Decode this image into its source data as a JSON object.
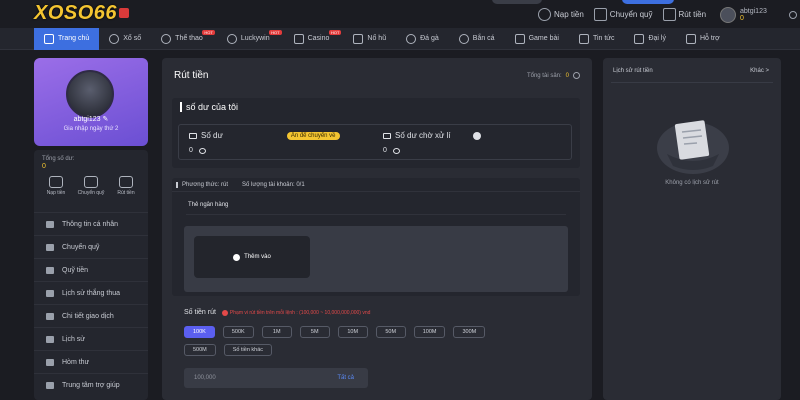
{
  "brand": {
    "logo_text": "XOSO66"
  },
  "top_actions": [
    {
      "label": "Nạp tiền",
      "icon": "deposit-icon"
    },
    {
      "label": "Chuyển quỹ",
      "icon": "transfer-icon"
    },
    {
      "label": "Rút tiền",
      "icon": "withdraw-icon"
    }
  ],
  "user": {
    "name": "abtgi123",
    "balance": "0"
  },
  "nav": [
    {
      "label": "Trang chủ",
      "icon": "home-icon",
      "hot": false,
      "active": true
    },
    {
      "label": "Xổ số",
      "icon": "lottery-icon",
      "hot": false
    },
    {
      "label": "Thể thao",
      "icon": "sports-icon",
      "hot": true
    },
    {
      "label": "Luckywin",
      "icon": "luckywin-icon",
      "hot": true
    },
    {
      "label": "Casino",
      "icon": "casino-icon",
      "hot": true
    },
    {
      "label": "Nổ hũ",
      "icon": "slots-icon",
      "hot": false
    },
    {
      "label": "Đá gà",
      "icon": "cockfight-icon",
      "hot": false
    },
    {
      "label": "Bắn cá",
      "icon": "fish-icon",
      "hot": false
    },
    {
      "label": "Game bài",
      "icon": "cards-icon",
      "hot": false
    },
    {
      "label": "Tin tức",
      "icon": "news-icon",
      "hot": false
    },
    {
      "label": "Đại lý",
      "icon": "agent-icon",
      "hot": false
    },
    {
      "label": "Hỗ trợ",
      "icon": "support-icon",
      "hot": false
    }
  ],
  "hot_badge": "HOT",
  "profile": {
    "username": "abtgi123",
    "login_text": "Gia nhập ngày thứ 2"
  },
  "sidebar": {
    "total_label": "Tổng số dư:",
    "total_value": "0",
    "quick": [
      {
        "label": "Nạp tiền"
      },
      {
        "label": "Chuyển quỹ"
      },
      {
        "label": "Rút tiền"
      }
    ],
    "menu": [
      {
        "label": "Thông tin cá nhân"
      },
      {
        "label": "Chuyển quỹ"
      },
      {
        "label": "Quỹ tiền"
      },
      {
        "label": "Lịch sử thắng thua"
      },
      {
        "label": "Chi tiết giao dịch"
      },
      {
        "label": "Lịch sử"
      },
      {
        "label": "Hòm thư"
      },
      {
        "label": "Trung tâm trợ giúp"
      }
    ]
  },
  "withdraw": {
    "title": "Rút tiền",
    "total_assets_label": "Tổng tài sản:",
    "total_assets_value": "0",
    "balance_title": "số dư của tôi",
    "balance_label": "Số dư",
    "hide_badge": "Ẩn để chuyển về",
    "balance_value": "0",
    "pending_label": "Số dư chờ xử lí",
    "pending_value": "0",
    "method_label": "Phương thức: rút",
    "account_count_label": "Số lượng tài khoản:",
    "account_count_value": "0/1",
    "bank_tab": "Thẻ ngân hàng",
    "add_label": "Thêm vào",
    "amount_label": "Số tiền rút",
    "amount_warning": "Phạm vi rút tiền trên mỗi lệnh : (100,000 ~ 10,000,000,000) vnd",
    "chips": [
      "100K",
      "500K",
      "1M",
      "5M",
      "10M",
      "50M",
      "100M",
      "300M",
      "500M",
      "Số tiền khác"
    ],
    "active_chip": "100K",
    "amount_placeholder": "100,000",
    "all_label": "Tất cả"
  },
  "history": {
    "title": "Lịch sử rút tiền",
    "more": "Khác >",
    "empty_text": "Không có lịch sử rút"
  }
}
